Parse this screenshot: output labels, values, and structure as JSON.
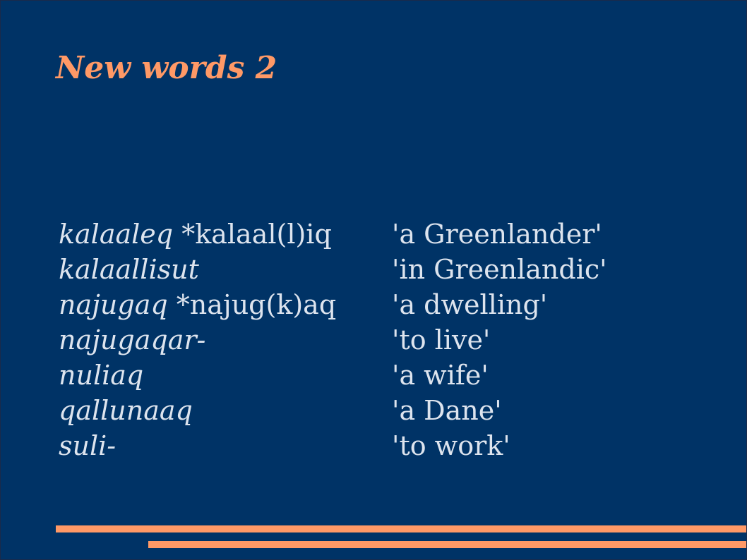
{
  "slide": {
    "title": "New words 2",
    "entries": [
      {
        "word": "kalaaleq",
        "proto": " *kalaal(l)iq",
        "gloss": "'a Greenlander'"
      },
      {
        "word": "kalaallisut",
        "proto": "",
        "gloss": "'in Greenlandic'"
      },
      {
        "word": "najugaq",
        "proto": " *najug(k)aq",
        "gloss": "'a dwelling'"
      },
      {
        "word": "najugaqar-",
        "proto": "",
        "gloss": "'to live'"
      },
      {
        "word": "nuliaq",
        "proto": "",
        "gloss": "'a wife'"
      },
      {
        "word": "qallunaaq",
        "proto": "",
        "gloss": "'a Dane'"
      },
      {
        "word": "suli-",
        "proto": "",
        "gloss": "'to work'"
      }
    ]
  },
  "colors": {
    "background": "#003366",
    "accent": "#ff9966",
    "text": "#dde4ee"
  }
}
